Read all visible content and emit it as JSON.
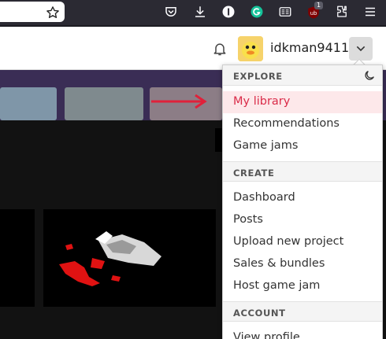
{
  "user": {
    "username": "idkman9411"
  },
  "dropdown": {
    "sections": [
      {
        "title": "EXPLORE",
        "items": [
          {
            "label": "My library",
            "active": true
          },
          {
            "label": "Recommendations"
          },
          {
            "label": "Game jams"
          }
        ]
      },
      {
        "title": "CREATE",
        "items": [
          {
            "label": "Dashboard"
          },
          {
            "label": "Posts"
          },
          {
            "label": "Upload new project"
          },
          {
            "label": "Sales & bundles"
          },
          {
            "label": "Host game jam"
          }
        ]
      },
      {
        "title": "ACCOUNT",
        "items": [
          {
            "label": "View profile"
          }
        ]
      }
    ]
  },
  "toolbar": {
    "extension_badge": "1"
  },
  "colors": {
    "accent": "#da2c49",
    "active_bg": "#fde8ea",
    "header_bg": "#ffffff",
    "browser_bg": "#2b2a33",
    "banner_bg": "#3a2d55"
  },
  "icons": [
    "star-icon",
    "pocket-icon",
    "download-icon",
    "info-icon",
    "grammarly-icon",
    "reader-icon",
    "ublock-icon",
    "extensions-icon",
    "menu-icon",
    "bell-icon",
    "chevron-down-icon",
    "moon-icon"
  ]
}
